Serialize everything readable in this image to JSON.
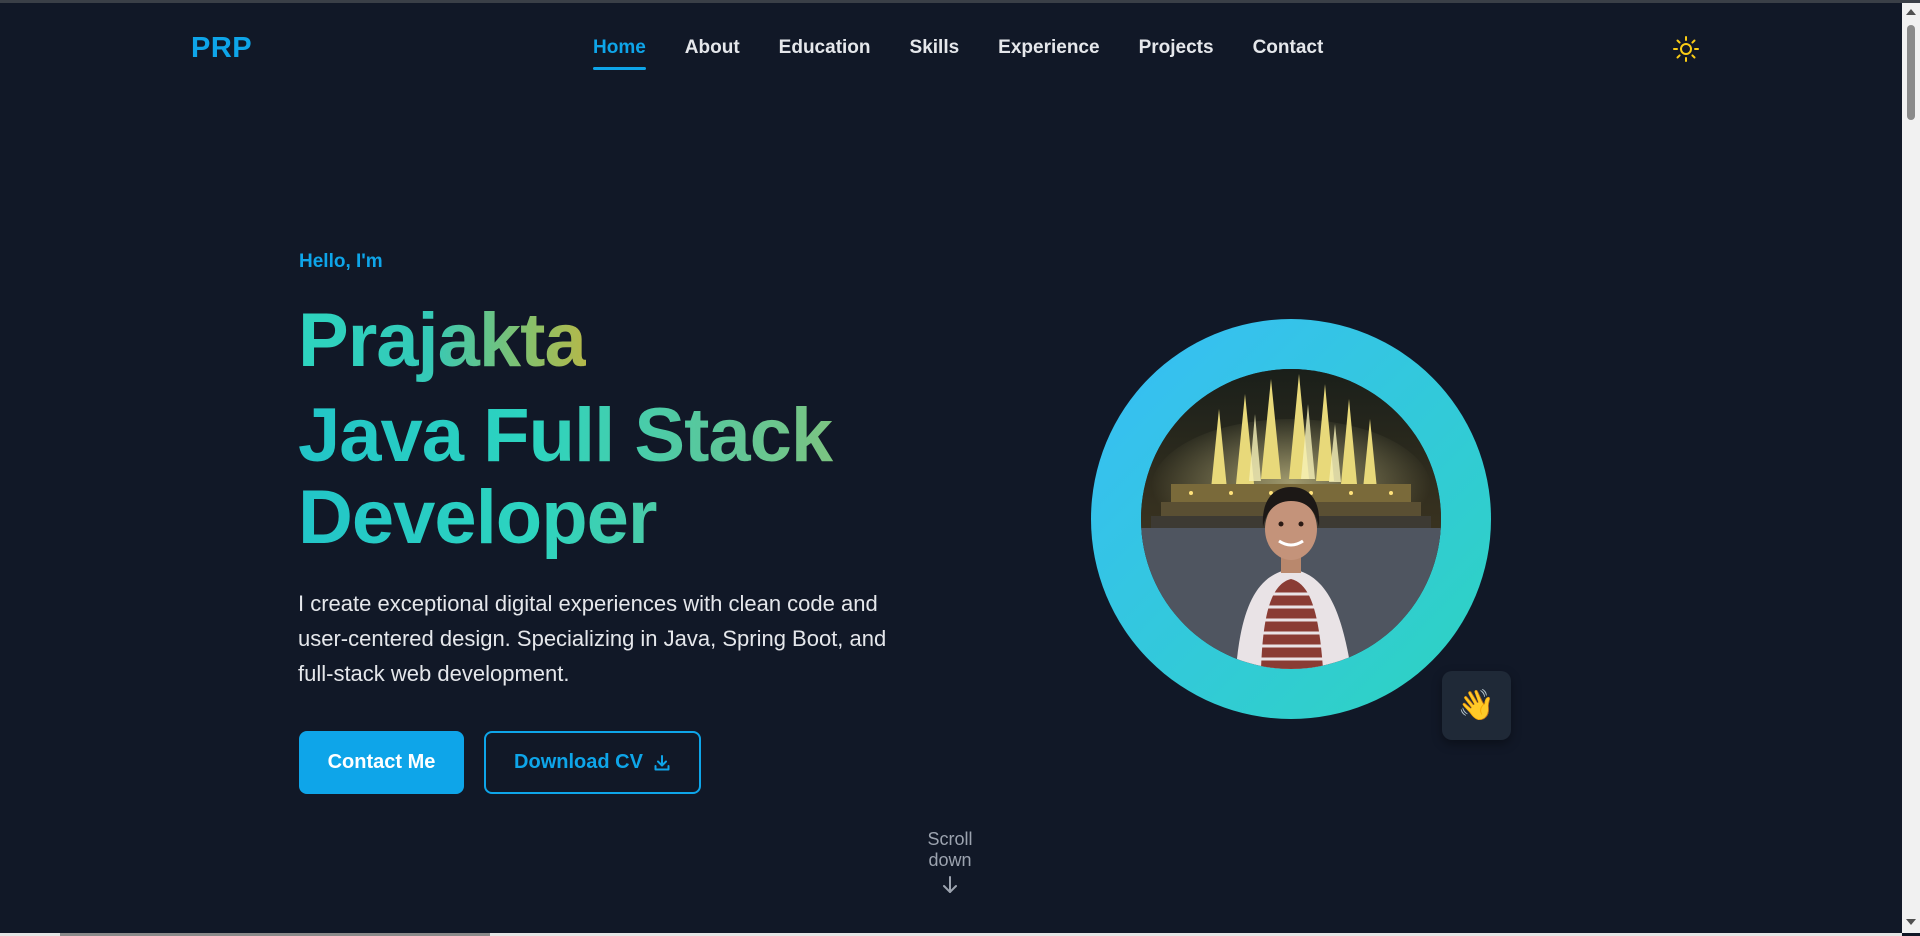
{
  "header": {
    "logo": "PRP",
    "nav": [
      {
        "label": "Home",
        "active": true
      },
      {
        "label": "About"
      },
      {
        "label": "Education"
      },
      {
        "label": "Skills"
      },
      {
        "label": "Experience"
      },
      {
        "label": "Projects"
      },
      {
        "label": "Contact"
      }
    ],
    "theme_toggle_icon": "sun-icon"
  },
  "hero": {
    "greeting": "Hello, I'm",
    "name": "Prajakta",
    "role": "Java Full Stack Developer",
    "description": "I create exceptional digital experiences with clean code and user-centered design. Specializing in Java, Spring Boot, and full-stack web development.",
    "primary_button": "Contact Me",
    "secondary_button": "Download CV",
    "secondary_button_icon": "download-icon",
    "badge_emoji": "👋",
    "scroll_hint": "Scroll down",
    "scroll_icon": "arrow-down-icon"
  },
  "colors": {
    "background": "#111827",
    "accent": "#0ea5e9",
    "gradient_start": "#38bdf8",
    "gradient_end": "#2dd4bf",
    "sun": "#facc15"
  }
}
